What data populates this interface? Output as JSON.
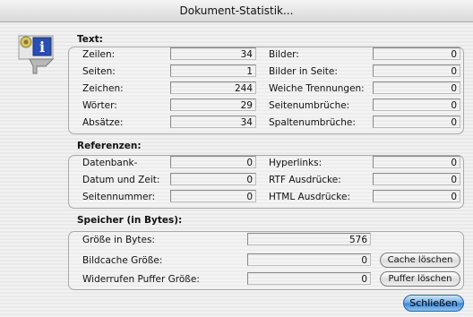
{
  "window": {
    "title": "Dokument-Statistik..."
  },
  "text_section": {
    "heading": "Text:",
    "left": [
      {
        "label": "Zeilen:",
        "value": "34"
      },
      {
        "label": "Seiten:",
        "value": "1"
      },
      {
        "label": "Zeichen:",
        "value": "244"
      },
      {
        "label": "Wörter:",
        "value": "29"
      },
      {
        "label": "Absätze:",
        "value": "34"
      }
    ],
    "right": [
      {
        "label": "Bilder:",
        "value": "0"
      },
      {
        "label": "Bilder in Seite:",
        "value": "0"
      },
      {
        "label": "Weiche Trennungen:",
        "value": "0"
      },
      {
        "label": "Seitenumbrüche:",
        "value": "0"
      },
      {
        "label": "Spaltenumbrüche:",
        "value": "0"
      }
    ]
  },
  "ref_section": {
    "heading": "Referenzen:",
    "left": [
      {
        "label": "Datenbank-",
        "value": "0"
      },
      {
        "label": "Datum und Zeit:",
        "value": "0"
      },
      {
        "label": "Seitennummer:",
        "value": "0"
      }
    ],
    "right": [
      {
        "label": "Hyperlinks:",
        "value": "0"
      },
      {
        "label": "RTF Ausdrücke:",
        "value": "0"
      },
      {
        "label": "HTML Ausdrücke:",
        "value": "0"
      }
    ]
  },
  "mem_section": {
    "heading": "Speicher (in Bytes):",
    "size": {
      "label": "Größe in Bytes:",
      "value": "576"
    },
    "image_cache": {
      "label": "Bildcache Größe:",
      "value": "0"
    },
    "undo_buffer": {
      "label": "Widerrufen Puffer Größe:",
      "value": "0"
    }
  },
  "buttons": {
    "clear_cache": "Cache löschen",
    "clear_buffer": "Puffer löschen",
    "close": "Schließen"
  },
  "icons": {
    "app": "document-info-icon"
  }
}
